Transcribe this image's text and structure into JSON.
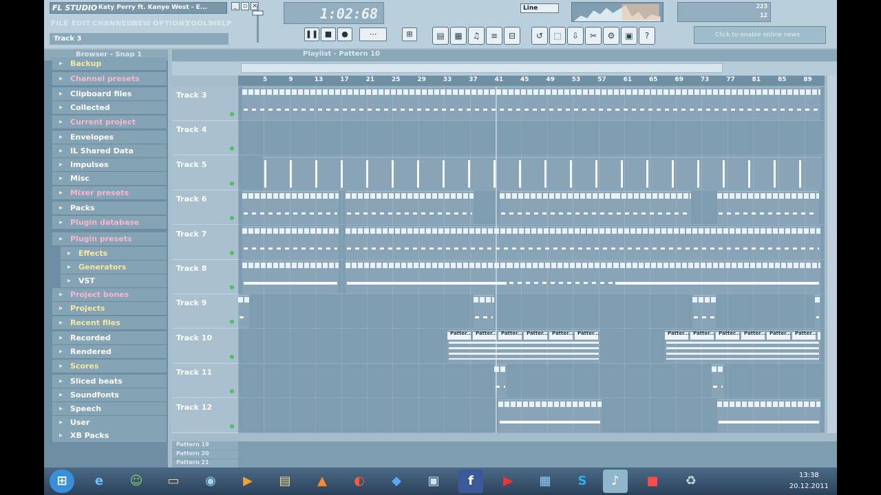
{
  "app": {
    "logo": "FL STUDIO",
    "song_title": "Katy Perry ft. Kanye West - E...",
    "hint": "Track 3"
  },
  "menu": [
    "FILE",
    "EDIT",
    "CHANNELS",
    "VIEW",
    "OPTIONS",
    "TOOLS",
    "HELP"
  ],
  "transport": {
    "time": "1:02:68",
    "snap_mode": "Line"
  },
  "cpu": {
    "ram": "223",
    "poly": "12"
  },
  "news": {
    "label": "Click to enable online news"
  },
  "browser": {
    "title": "Browser - Snap 1",
    "items": [
      {
        "label": "Backup",
        "color": "#f5e8a0",
        "icon": "folder-icon"
      },
      {
        "label": "Channel presets",
        "color": "#f6b7cf",
        "icon": "folder-icon"
      },
      {
        "label": "Clipboard files",
        "color": "#ffffff",
        "icon": "folder-icon"
      },
      {
        "label": "Collected",
        "color": "#ffffff",
        "icon": "folder-icon"
      },
      {
        "label": "Current project",
        "color": "#f6b7cf",
        "icon": "folder-icon"
      },
      {
        "label": "Envelopes",
        "color": "#ffffff",
        "icon": "folder-icon"
      },
      {
        "label": "IL Shared Data",
        "color": "#ffffff",
        "icon": "folder-icon"
      },
      {
        "label": "Impulses",
        "color": "#ffffff",
        "icon": "folder-icon"
      },
      {
        "label": "Misc",
        "color": "#ffffff",
        "icon": "folder-icon"
      },
      {
        "label": "Mixer presets",
        "color": "#f6b7cf",
        "icon": "folder-icon"
      },
      {
        "label": "Packs",
        "color": "#ffffff",
        "icon": "folder-icon"
      },
      {
        "label": "Plugin database",
        "color": "#f6b7cf",
        "icon": "plugin-icon"
      },
      {
        "label": "Plugin presets",
        "color": "#f6b7cf",
        "icon": "plugin-icon"
      },
      {
        "label": "Effects",
        "color": "#f5e8a0",
        "icon": "effects-icon",
        "sub": true
      },
      {
        "label": "Generators",
        "color": "#f5e8a0",
        "icon": "generators-icon",
        "sub": true
      },
      {
        "label": "VST",
        "color": "#ffffff",
        "icon": "vst-icon",
        "sub": true
      },
      {
        "label": "Project bones",
        "color": "#f6b7cf",
        "icon": "folder-icon"
      },
      {
        "label": "Projects",
        "color": "#f5e8a0",
        "icon": "folder-icon"
      },
      {
        "label": "Recent files",
        "color": "#f5e8a0",
        "icon": "folder-icon"
      },
      {
        "label": "Recorded",
        "color": "#ffffff",
        "icon": "folder-icon"
      },
      {
        "label": "Rendered",
        "color": "#ffffff",
        "icon": "folder-icon"
      },
      {
        "label": "Scores",
        "color": "#f5e8a0",
        "icon": "folder-icon"
      },
      {
        "label": "Sliced beats",
        "color": "#ffffff",
        "icon": "folder-icon"
      },
      {
        "label": "Soundfonts",
        "color": "#ffffff",
        "icon": "folder-icon"
      },
      {
        "label": "Speech",
        "color": "#ffffff",
        "icon": "folder-icon"
      },
      {
        "label": "User",
        "color": "#ffffff",
        "icon": "folder-icon"
      },
      {
        "label": "XB Packs",
        "color": "#ffffff",
        "icon": "folder-icon"
      }
    ]
  },
  "playlist": {
    "title": "Playlist - Pattern 10",
    "ruler": [
      "5",
      "9",
      "13",
      "17",
      "21",
      "25",
      "29",
      "33",
      "37",
      "41",
      "45",
      "49",
      "53",
      "57",
      "61",
      "65",
      "69",
      "73",
      "77",
      "81",
      "85",
      "89"
    ],
    "tracks": [
      "Track 3",
      "Track 4",
      "Track 5",
      "Track 6",
      "Track 7",
      "Track 8",
      "Track 9",
      "Track 10",
      "Track 11",
      "Track 12"
    ],
    "clip_label": "Patter...",
    "patterns": [
      "Pattern 19",
      "Pattern 20",
      "Pattern 21"
    ]
  },
  "taskbar": {
    "time": "13:38",
    "date": "20.12.2011"
  }
}
